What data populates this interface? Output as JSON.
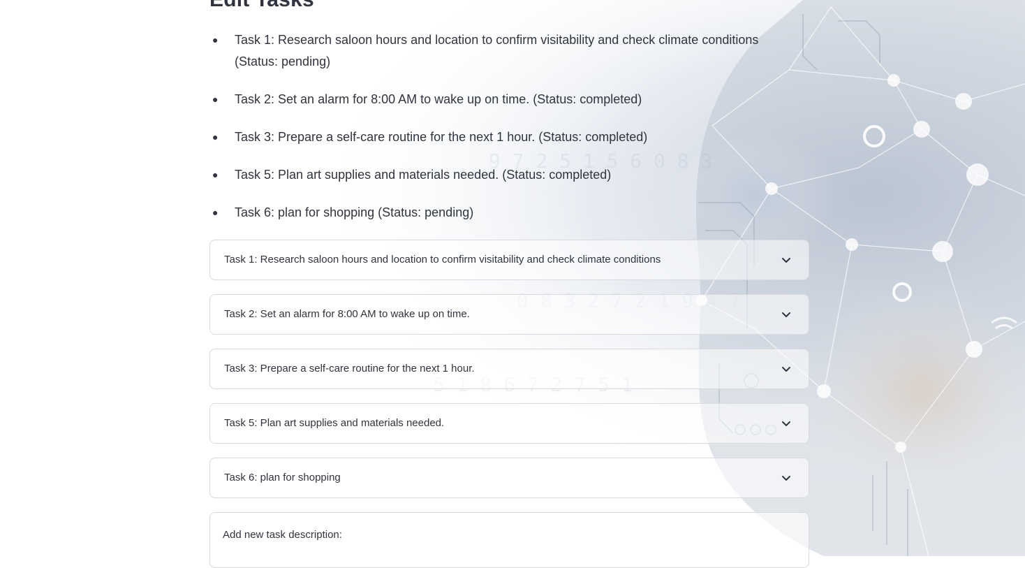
{
  "page": {
    "title": "Edit Tasks"
  },
  "task_list": [
    {
      "text": "Task 1: Research saloon hours and location to confirm visitability and check climate conditions (Status: pending)"
    },
    {
      "text": "Task 2: Set an alarm for 8:00 AM to wake up on time. (Status: completed)"
    },
    {
      "text": "Task 3: Prepare a self-care routine for the next 1 hour. (Status: completed)"
    },
    {
      "text": "Task 5: Plan art supplies and materials needed. (Status: completed)"
    },
    {
      "text": "Task 6: plan for shopping (Status: pending)"
    }
  ],
  "expanders": [
    {
      "label": "Task 1: Research saloon hours and location to confirm visitability and check climate conditions"
    },
    {
      "label": "Task 2: Set an alarm for 8:00 AM to wake up on time."
    },
    {
      "label": "Task 3: Prepare a self-care routine for the next 1 hour."
    },
    {
      "label": "Task 5: Plan art supplies and materials needed."
    },
    {
      "label": "Task 6: plan for shopping"
    }
  ],
  "add_task": {
    "label": "Add new task description:"
  },
  "icons": {
    "expander_toggle": "chevron-down-icon",
    "list_marker": "bullet"
  },
  "colors": {
    "text": "#31333f",
    "border": "#d9d9de",
    "background": "#ffffff"
  }
}
